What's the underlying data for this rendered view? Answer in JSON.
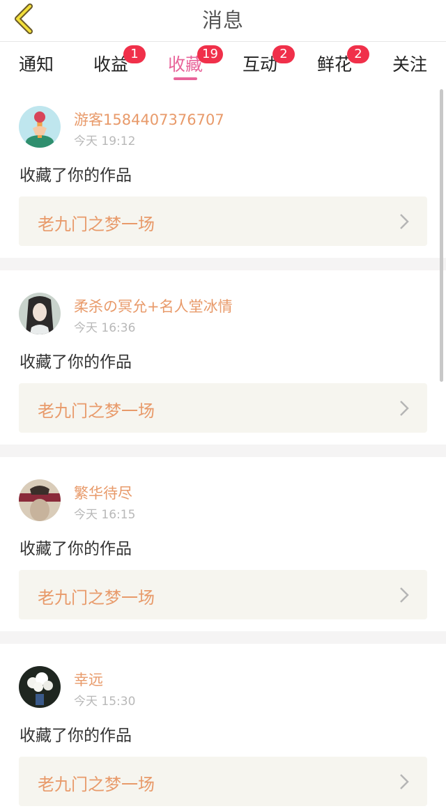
{
  "header": {
    "title": "消息",
    "back_icon": "back-chevron-icon"
  },
  "tabs": [
    {
      "label": "通知",
      "badge": ""
    },
    {
      "label": "收益",
      "badge": "1"
    },
    {
      "label": "收藏",
      "badge": "19",
      "active": true
    },
    {
      "label": "互动",
      "badge": "2"
    },
    {
      "label": "鲜花",
      "badge": "2"
    },
    {
      "label": "关注",
      "badge": ""
    }
  ],
  "colors": {
    "accent": "#e8649a",
    "badge": "#f0304a",
    "username": "#e89a6a",
    "card_bg": "#f6f5ef"
  },
  "messages": [
    {
      "username": "游客1584407376707",
      "time": "今天 19:12",
      "action": "收藏了你的作品",
      "work_title": "老九门之梦一场"
    },
    {
      "username": "柔杀の冥允+名人堂冰情",
      "time": "今天 16:36",
      "action": "收藏了你的作品",
      "work_title": "老九门之梦一场"
    },
    {
      "username": "繁华待尽",
      "time": "今天 16:15",
      "action": "收藏了你的作品",
      "work_title": "老九门之梦一场"
    },
    {
      "username": "幸远",
      "time": "今天 15:30",
      "action": "收藏了你的作品",
      "work_title": "老九门之梦一场"
    }
  ]
}
